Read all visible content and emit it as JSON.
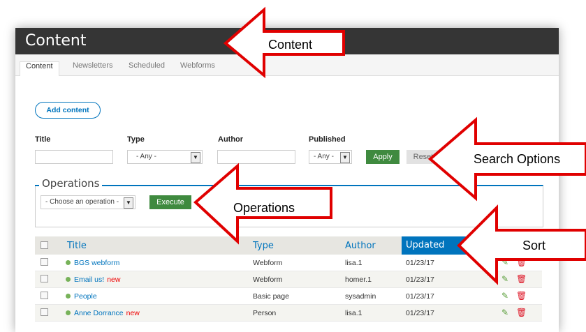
{
  "header": {
    "title": "Content"
  },
  "tabs": [
    "Content",
    "Newsletters",
    "Scheduled",
    "Webforms"
  ],
  "actions": {
    "add_content": "Add content"
  },
  "filters": {
    "title_label": "Title",
    "type_label": "Type",
    "type_value": "- Any -",
    "author_label": "Author",
    "published_label": "Published",
    "published_value": "- Any -",
    "apply": "Apply",
    "reset": "Reset"
  },
  "operations": {
    "legend": "Operations",
    "select_value": "- Choose an operation -",
    "execute": "Execute"
  },
  "table": {
    "columns": [
      "Title",
      "Type",
      "Author",
      "Updated"
    ],
    "rows": [
      {
        "title": "BGS webform",
        "new": "",
        "type": "Webform",
        "author": "lisa.1",
        "updated": "01/23/17"
      },
      {
        "title": "Email us!",
        "new": "new",
        "type": "Webform",
        "author": "homer.1",
        "updated": "01/23/17"
      },
      {
        "title": "People",
        "new": "",
        "type": "Basic page",
        "author": "sysadmin",
        "updated": "01/23/17"
      },
      {
        "title": "Anne Dorrance",
        "new": "new",
        "type": "Person",
        "author": "lisa.1",
        "updated": "01/23/17"
      }
    ]
  },
  "annotations": {
    "content": "Content",
    "search": "Search Options",
    "operations": "Operations",
    "sort": "Sort"
  },
  "colors": {
    "accent": "#0074bd",
    "header": "#353535",
    "green": "#3f8a3f",
    "callout": "#e00000"
  }
}
